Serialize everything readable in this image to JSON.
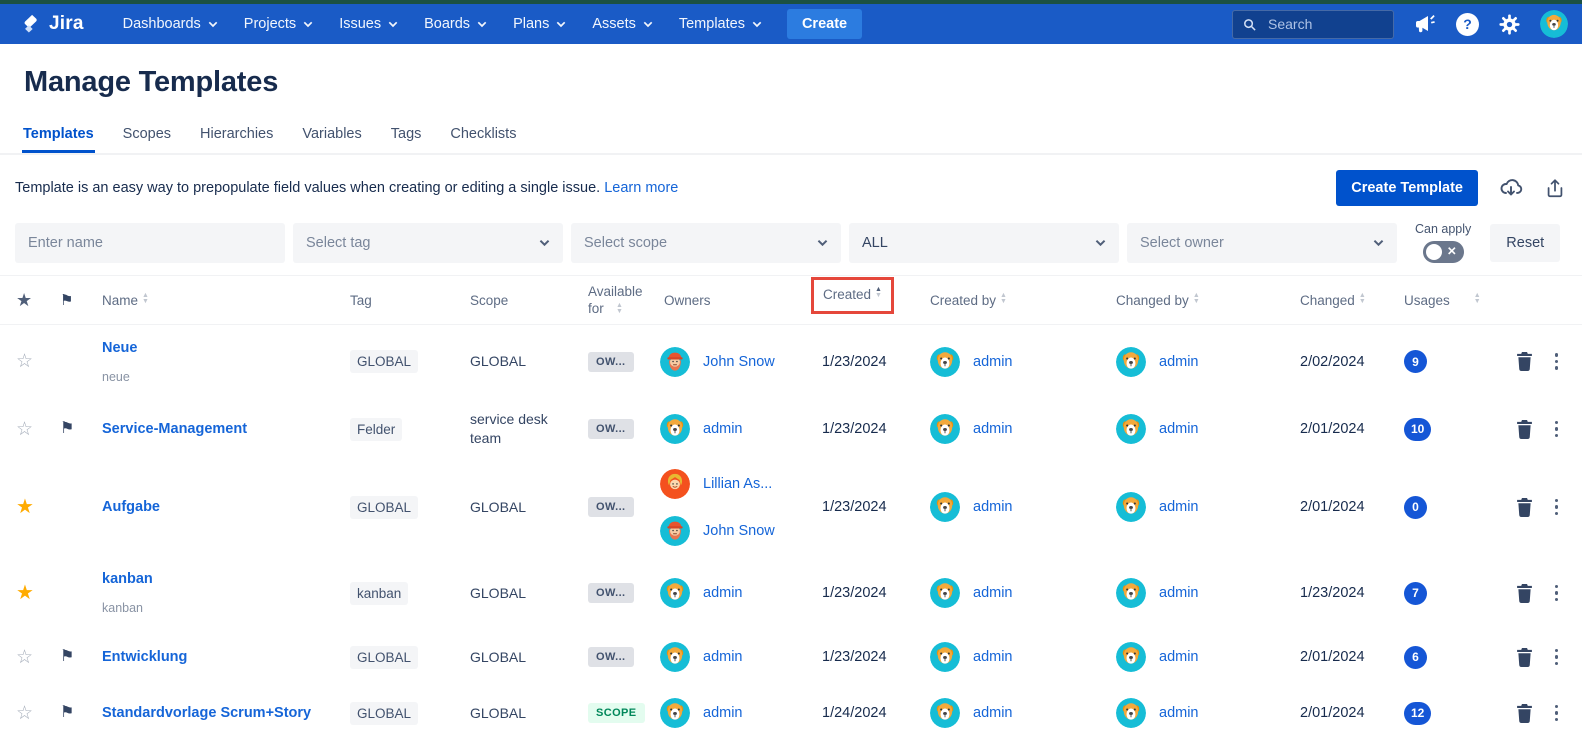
{
  "colors": {
    "nav_background": "#1A5BC6",
    "accent_blue": "#0052CC",
    "link_blue": "#1565D8",
    "usages_badge_blue": "#1556D6",
    "annotation_red": "#E5473B",
    "scope_badge_green": "#00875A",
    "favorite_yellow": "#FFAB00"
  },
  "nav": {
    "brand": "Jira",
    "items": [
      "Dashboards",
      "Projects",
      "Issues",
      "Boards",
      "Plans",
      "Assets",
      "Templates"
    ],
    "create_label": "Create",
    "search_placeholder": "Search"
  },
  "page": {
    "title": "Manage Templates",
    "tabs": [
      "Templates",
      "Scopes",
      "Hierarchies",
      "Variables",
      "Tags",
      "Checklists"
    ],
    "active_tab": "Templates",
    "description": "Template is an easy way to prepopulate field values when creating or editing a single issue.",
    "learn_more_label": "Learn more",
    "create_template_label": "Create Template"
  },
  "filters": {
    "name_placeholder": "Enter name",
    "tag_placeholder": "Select tag",
    "scope_placeholder": "Select scope",
    "type_value": "ALL",
    "owner_placeholder": "Select owner",
    "can_apply_label": "Can apply",
    "toggle_state": "off",
    "reset_label": "Reset"
  },
  "table": {
    "headers": {
      "name": "Name",
      "tag": "Tag",
      "scope": "Scope",
      "available_for": "Available for",
      "owners": "Owners",
      "created": "Created",
      "created_by": "Created by",
      "changed_by": "Changed by",
      "changed": "Changed",
      "usages": "Usages"
    },
    "sorted_column": "created",
    "sort_direction": "asc",
    "annotated_header": "created",
    "rows": [
      {
        "name": "Neue",
        "subtitle": "neue",
        "starred": false,
        "flagged": false,
        "tag": "GLOBAL",
        "scope": "GLOBAL",
        "available_badge": {
          "label": "OW...",
          "variant": "owner"
        },
        "owners": [
          {
            "name": "John Snow",
            "avatar": "john-snow"
          }
        ],
        "created": "1/23/2024",
        "created_by": "admin",
        "changed_by": "admin",
        "changed": "2/02/2024",
        "usages": "9"
      },
      {
        "name": "Service-Management",
        "subtitle": "",
        "starred": false,
        "flagged": true,
        "tag": "Felder",
        "scope": "service desk team",
        "available_badge": {
          "label": "OW...",
          "variant": "owner"
        },
        "owners": [
          {
            "name": "admin",
            "avatar": "dog"
          }
        ],
        "created": "1/23/2024",
        "created_by": "admin",
        "changed_by": "admin",
        "changed": "2/01/2024",
        "usages": "10"
      },
      {
        "name": "Aufgabe",
        "subtitle": "",
        "starred": true,
        "flagged": false,
        "tag": "GLOBAL",
        "scope": "GLOBAL",
        "available_badge": {
          "label": "OW...",
          "variant": "owner"
        },
        "owners": [
          {
            "name": "Lillian As...",
            "avatar": "lillian"
          },
          {
            "name": "John Snow",
            "avatar": "john-snow"
          }
        ],
        "created": "1/23/2024",
        "created_by": "admin",
        "changed_by": "admin",
        "changed": "2/01/2024",
        "usages": "0"
      },
      {
        "name": "kanban",
        "subtitle": "kanban",
        "starred": true,
        "flagged": false,
        "tag": "kanban",
        "scope": "GLOBAL",
        "available_badge": {
          "label": "OW...",
          "variant": "owner"
        },
        "owners": [
          {
            "name": "admin",
            "avatar": "dog"
          }
        ],
        "created": "1/23/2024",
        "created_by": "admin",
        "changed_by": "admin",
        "changed": "1/23/2024",
        "usages": "7"
      },
      {
        "name": "Entwicklung",
        "subtitle": "",
        "starred": false,
        "flagged": true,
        "tag": "GLOBAL",
        "scope": "GLOBAL",
        "available_badge": {
          "label": "OW...",
          "variant": "owner"
        },
        "owners": [
          {
            "name": "admin",
            "avatar": "dog"
          }
        ],
        "created": "1/23/2024",
        "created_by": "admin",
        "changed_by": "admin",
        "changed": "2/01/2024",
        "usages": "6"
      },
      {
        "name": "Standardvorlage Scrum+Story",
        "subtitle": "",
        "starred": false,
        "flagged": true,
        "tag": "GLOBAL",
        "scope": "GLOBAL",
        "available_badge": {
          "label": "SCOPE",
          "variant": "scope"
        },
        "owners": [
          {
            "name": "admin",
            "avatar": "dog"
          }
        ],
        "created": "1/24/2024",
        "created_by": "admin",
        "changed_by": "admin",
        "changed": "2/01/2024",
        "usages": "12"
      }
    ]
  }
}
